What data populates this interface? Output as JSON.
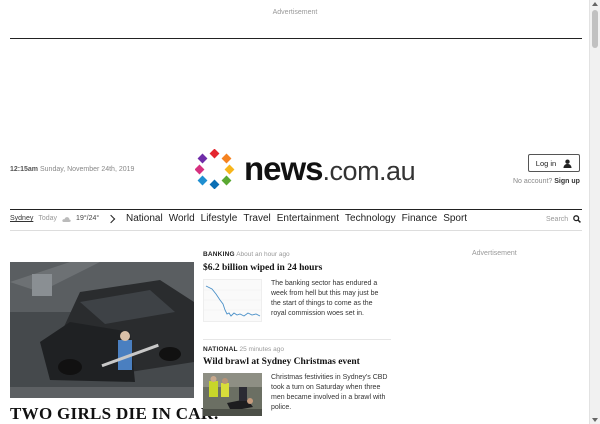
{
  "ads": {
    "top": "Advertisement",
    "side": "Advertisement"
  },
  "header": {
    "time": "12:15am",
    "date": "Sunday, November 24th, 2019",
    "logo_main": "news",
    "logo_tld": ".com.au",
    "login_label": "Log in",
    "no_account": "No account?",
    "signup_label": "Sign up"
  },
  "weather": {
    "city": "Sydney",
    "day": "Today",
    "temps": "19°/24°",
    "icon": "cloud-icon"
  },
  "nav": {
    "items": [
      "National",
      "World",
      "Lifestyle",
      "Travel",
      "Entertainment",
      "Technology",
      "Finance",
      "Sport"
    ],
    "search_label": "Search"
  },
  "hero": {
    "title": "TWO GIRLS DIE IN CAR:"
  },
  "stories": [
    {
      "category": "BANKING",
      "time": "About an hour ago",
      "headline": "$6.2 billion wiped in 24 hours",
      "body": "The banking sector has endured a week from hell but this may just be the start of things to come as the royal commission woes set in."
    },
    {
      "category": "NATIONAL",
      "time": "25 minutes ago",
      "headline": "Wild brawl at Sydney Christmas event",
      "body": "Christmas festivities in Sydney's CBD took a turn on Saturday when three men became involved in a brawl with police."
    }
  ],
  "colors": {
    "accent_red": "#e4262f",
    "purple": "#6f2da8",
    "green": "#5aa832",
    "blue": "#1f8fd1",
    "orange": "#f58220"
  }
}
